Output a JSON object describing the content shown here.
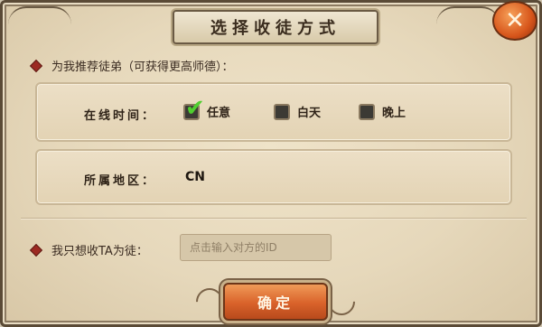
{
  "dialog": {
    "title": "选择收徒方式",
    "close_icon": "close-x-icon"
  },
  "recommend": {
    "label": "为我推荐徒弟（可获得更高师德）：",
    "online_time": {
      "label": "在线时间：",
      "options": [
        {
          "label": "任意",
          "checked": true
        },
        {
          "label": "白天",
          "checked": false
        },
        {
          "label": "晚上",
          "checked": false
        }
      ]
    },
    "region": {
      "label": "所属地区：",
      "value": "CN"
    }
  },
  "specific": {
    "label": "我只想收TA为徒：",
    "input_placeholder": "点击输入对方的ID",
    "input_value": ""
  },
  "confirm_label": "确定",
  "colors": {
    "accent": "#d9622a",
    "bullet": "#9c2a22",
    "check": "#4fcf2f"
  }
}
